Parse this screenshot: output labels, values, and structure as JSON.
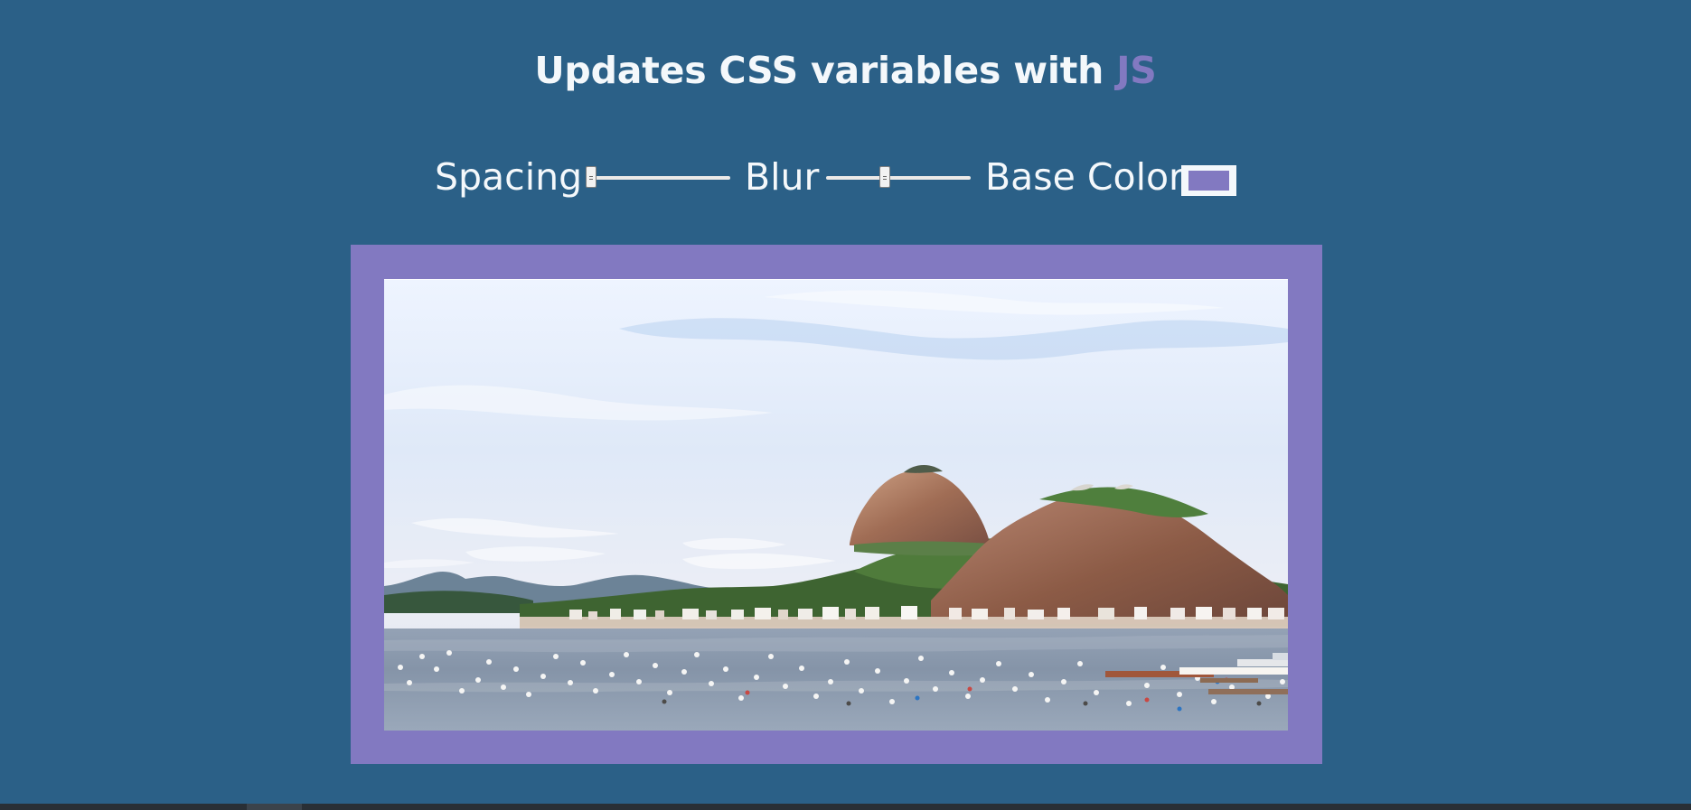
{
  "header": {
    "title_prefix": "Updates CSS variables with ",
    "title_accent": "JS"
  },
  "controls": {
    "spacing": {
      "label": "Spacing",
      "value": 0.0
    },
    "blur": {
      "label": "Blur",
      "value": 0.4
    },
    "base_color": {
      "label": "Base Color",
      "value": "#8279c1"
    }
  },
  "image": {
    "icon": "landscape-photo-icon"
  },
  "colors": {
    "page_background": "#2b6087",
    "title_text": "#f4f8fb",
    "accent": "#8279c1",
    "frame_background": "#8279c1"
  }
}
